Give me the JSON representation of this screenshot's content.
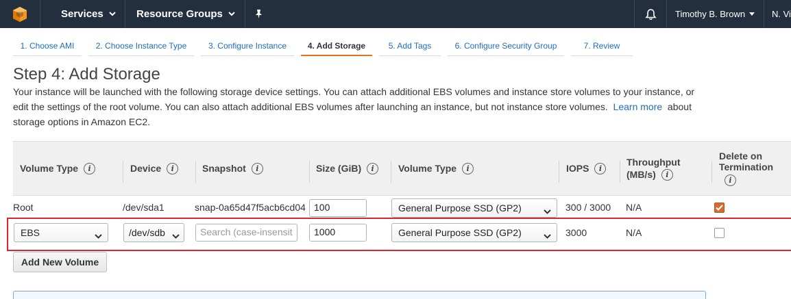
{
  "nav": {
    "services": "Services",
    "resource_groups": "Resource Groups",
    "user": "Timothy B. Brown",
    "region": "N. Vi"
  },
  "tabs": [
    {
      "label": "1. Choose AMI"
    },
    {
      "label": "2. Choose Instance Type"
    },
    {
      "label": "3. Configure Instance"
    },
    {
      "label": "4. Add Storage",
      "active": true
    },
    {
      "label": "5. Add Tags"
    },
    {
      "label": "6. Configure Security Group"
    },
    {
      "label": "7. Review"
    }
  ],
  "page": {
    "title": "Step 4: Add Storage",
    "desc_line1": "Your instance will be launched with the following storage device settings. You can attach additional EBS volumes and instance store volumes to your instance, or",
    "desc_line2": "edit the settings of the root volume. You can also attach additional EBS volumes after launching an instance, but not instance store volumes.",
    "learn_more": "Learn more",
    "about": "about",
    "desc_line3": "storage options in Amazon EC2."
  },
  "table": {
    "headers": {
      "volume_type": "Volume Type",
      "device": "Device",
      "snapshot": "Snapshot",
      "size": "Size (GiB)",
      "volume_type2": "Volume Type",
      "iops": "IOPS",
      "throughput_1": "Throughput",
      "throughput_2": "(MB/s)",
      "delete_1": "Delete on",
      "delete_2": "Termination"
    },
    "info_glyph": "i",
    "root": {
      "type": "Root",
      "device": "/dev/sda1",
      "snapshot": "snap-0a65d47f5acb6cd04",
      "size": "100",
      "volume_type": "General Purpose SSD (GP2)",
      "iops": "300 / 3000",
      "throughput": "N/A",
      "delete_on_termination": true
    },
    "ebs": {
      "type": "EBS",
      "device": "/dev/sdb",
      "snapshot_placeholder": "Search (case-insensit",
      "size": "1000",
      "volume_type": "General Purpose SSD (GP2)",
      "iops": "3000",
      "throughput": "N/A",
      "delete_on_termination": false
    }
  },
  "actions": {
    "add_volume": "Add New Volume"
  },
  "colors": {
    "nav_bg": "#232f3e",
    "accent": "#ec7211",
    "link": "#1a6ec6",
    "highlight": "#d8262c",
    "checkbox_checked": "#d46b2f"
  }
}
